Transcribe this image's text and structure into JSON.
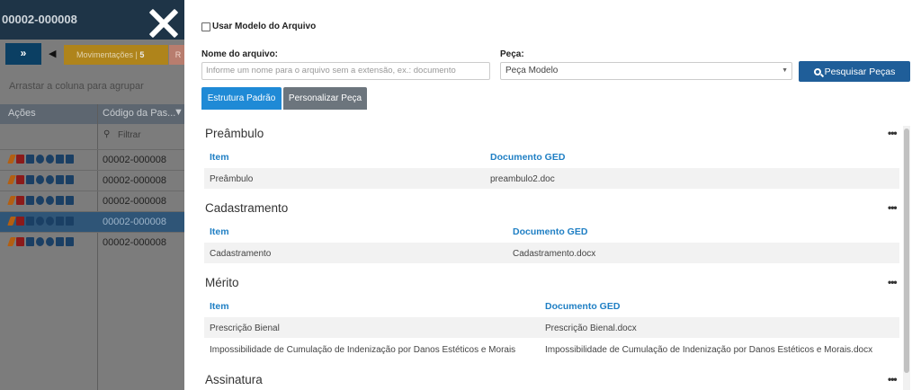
{
  "background": {
    "header_title": "00002-000008",
    "expand_label": "»",
    "caret_label": "◀",
    "tab_movimentacoes": "Movimentações",
    "tab_movimentacoes_count": "5",
    "tab_r": "R",
    "group_hint": "Arrastar a coluna para agrupar",
    "col_acoes": "Ações",
    "col_codigo": "Código da Pas...",
    "filter_placeholder": "Filtrar",
    "rows": [
      {
        "code": "00002-000008"
      },
      {
        "code": "00002-000008"
      },
      {
        "code": "00002-000008"
      },
      {
        "code": "00002-000008"
      },
      {
        "code": "00002-000008"
      }
    ]
  },
  "form": {
    "use_template_label": "Usar Modelo do Arquivo",
    "file_name_label": "Nome do arquivo:",
    "file_name_placeholder": "Informe um nome para o arquivo sem a extensão, ex.: documento",
    "peca_label": "Peça:",
    "peca_value": "Peça Modelo",
    "search_button": "Pesquisar Peças",
    "tab_padrao": "Estrutura Padrão",
    "tab_personalizar": "Personalizar Peça"
  },
  "sections": [
    {
      "title": "Preâmbulo",
      "col_item": "Item",
      "col_doc": "Documento GED",
      "rows": [
        {
          "item": "Preâmbulo",
          "doc": "preambulo2.doc"
        }
      ]
    },
    {
      "title": "Cadastramento",
      "col_item": "Item",
      "col_doc": "Documento GED",
      "rows": [
        {
          "item": "Cadastramento",
          "doc": "Cadastramento.docx"
        }
      ]
    },
    {
      "title": "Mérito",
      "col_item": "Item",
      "col_doc": "Documento GED",
      "rows": [
        {
          "item": "Prescrição Bienal",
          "doc": "Prescrição Bienal.docx"
        },
        {
          "item": "Impossibilidade de Cumulação de Indenização por Danos Estéticos e Morais",
          "doc": "Impossibilidade de Cumulação de Indenização por Danos Estéticos e Morais.docx"
        }
      ]
    },
    {
      "title": "Assinatura"
    }
  ],
  "more_label": "•••",
  "icons": [
    "close-icon",
    "search-icon",
    "filter-icon",
    "pencil-icon",
    "trash-icon",
    "calendar-icon",
    "user-icon",
    "clock-icon",
    "cloud-icon",
    "file-icon",
    "more-icon",
    "dropdown-arrow-icon"
  ],
  "colors": {
    "primary": "#1f8ad6",
    "search_button": "#1f5e99",
    "header_text": "#1f7fc4",
    "dark_header": "#1e3447"
  }
}
